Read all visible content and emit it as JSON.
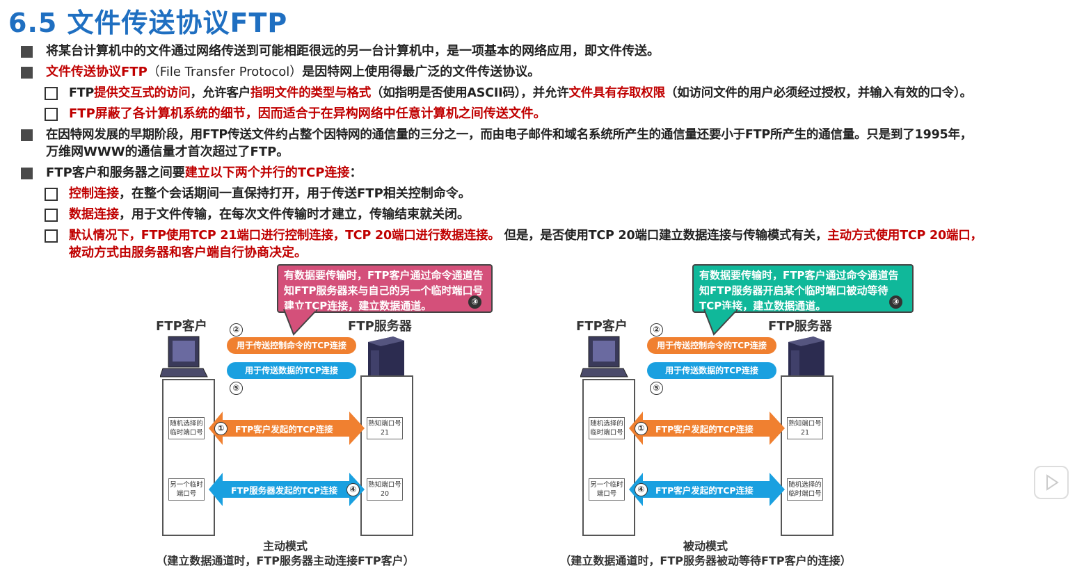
{
  "title": "6.5 文件传送协议FTP",
  "bullets": {
    "b1": "将某台计算机中的文件通过网络传送到可能相距很远的另一台计算机中，是一项基本的网络应用，即文件传送。",
    "b2_red": "文件传送协议FTP",
    "b2_paren": "（File Transfer Protocol）",
    "b2_rest": "是因特网上使用得最广泛的文件传送协议。",
    "s1_a": "FTP",
    "s1_b": "提供交互式的访问",
    "s1_c": "，允许客户",
    "s1_d": "指明文件的类型与格式",
    "s1_e": "（如指明是否使用ASCII码），并允许",
    "s1_f": "文件具有存取权限",
    "s1_g": "（如访问文件的用户必须经过授权，并输入有效的口令）。",
    "s2": "FTP屏蔽了各计算机系统的细节，因而适合于在异构网络中任意计算机之间传送文件。",
    "b3_line1": "在因特网发展的早期阶段，用FTP传送文件约占整个因特网的通信量的三分之一，而由电子邮件和域名系统所产生的通信量还要小于FTP所产生的通信量。只是到了1995年，",
    "b3_line2": "万维网WWW的通信量才首次超过了FTP。",
    "b4_a": "FTP客户和服务器之间要",
    "b4_b": "建立以下两个并行的TCP连接",
    "b4_c": "：",
    "t1_a": "控制连接",
    "t1_b": "，在整个会话期间一直保持打开，用于传送FTP相关控制命令。",
    "t2_a": "数据连接",
    "t2_b": "，用于文件传输，在每次文件传输时才建立，传输结束就关闭。",
    "t3_a": "默认情况下，FTP使用TCP 21端口进行控制连接，TCP 20端口进行数据连接。",
    "t3_b": " 但是，是否使用TCP 20端口建立数据连接与传输模式有关，",
    "t3_c": "主动方式使用TCP 20端口，",
    "t3_d": "被动方式由服务器和客户端自行协商决定。"
  },
  "colors": {
    "title": "#1f6fc1",
    "red": "#c00000",
    "orange": "#f08030",
    "blue": "#1aa0e0",
    "pink": "#d4507a",
    "teal": "#10b89a"
  },
  "active": {
    "callout": "有数据要传输时，FTP客户通过命令通道告知FTP服务器来与自己的另一个临时端口号建立TCP连接，建立数据通道。",
    "callout_num": "③",
    "client": "FTP客户",
    "server": "FTP服务器",
    "num2": "②",
    "num5": "⑤",
    "pill_control": "用于传送控制命令的TCP连接",
    "pill_data": "用于传送数据的TCP连接",
    "left1": "随机选择的临时端口号",
    "arrow1_num": "①",
    "arrow1": "FTP客户发起的TCP连接",
    "right1": "熟知端口号21",
    "left2": "另一个临时端口号",
    "arrow2": "FTP服务器发起的TCP连接",
    "arrow2_num": "④",
    "right2": "熟知端口号20",
    "caption1": "主动模式",
    "caption2": "（建立数据通道时，FTP服务器主动连接FTP客户）"
  },
  "passive": {
    "callout": "有数据要传输时，FTP客户通过命令通道告知FTP服务器开启某个临时端口被动等待TCP连接，建立数据通道。",
    "callout_num": "③",
    "client": "FTP客户",
    "server": "FTP服务器",
    "num2": "②",
    "num5": "⑤",
    "pill_control": "用于传送控制命令的TCP连接",
    "pill_data": "用于传送数据的TCP连接",
    "left1": "随机选择的临时端口号",
    "arrow1_num": "①",
    "arrow1": "FTP客户发起的TCP连接",
    "right1": "熟知端口号21",
    "left2": "另一个临时端口号",
    "arrow2_num": "④",
    "arrow2": "FTP客户发起的TCP连接",
    "right2": "随机选择的临时端口号",
    "caption1": "被动模式",
    "caption2": "（建立数据通道时，FTP服务器被动等待FTP客户的连接）"
  }
}
